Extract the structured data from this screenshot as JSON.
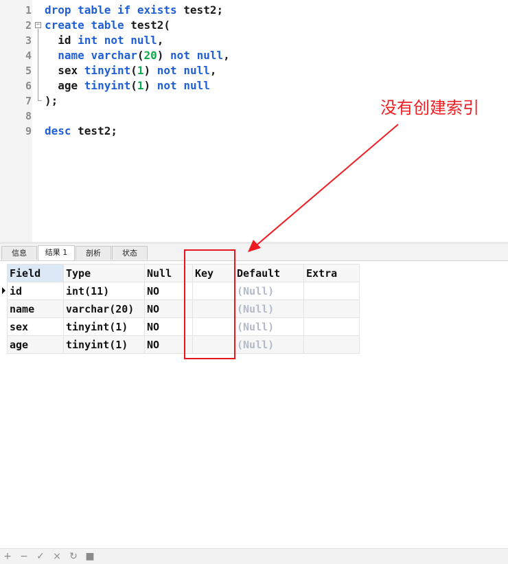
{
  "editor": {
    "line_numbers": [
      "1",
      "2",
      "3",
      "4",
      "5",
      "6",
      "7",
      "8",
      "9"
    ],
    "lines": [
      [
        {
          "t": "drop table if exists",
          "c": "kw"
        },
        {
          "t": " test2;",
          "c": ""
        }
      ],
      [
        {
          "t": "create table",
          "c": "kw"
        },
        {
          "t": " test2(",
          "c": ""
        }
      ],
      [
        {
          "t": "  id ",
          "c": ""
        },
        {
          "t": "int not null",
          "c": "kw"
        },
        {
          "t": ",",
          "c": ""
        }
      ],
      [
        {
          "t": "  name ",
          "c": "kw"
        },
        {
          "t": "varchar",
          "c": "kw"
        },
        {
          "t": "(",
          "c": ""
        },
        {
          "t": "20",
          "c": "num"
        },
        {
          "t": ") ",
          "c": ""
        },
        {
          "t": "not null",
          "c": "kw"
        },
        {
          "t": ",",
          "c": ""
        }
      ],
      [
        {
          "t": "  sex ",
          "c": ""
        },
        {
          "t": "tinyint",
          "c": "kw"
        },
        {
          "t": "(",
          "c": ""
        },
        {
          "t": "1",
          "c": "num"
        },
        {
          "t": ") ",
          "c": ""
        },
        {
          "t": "not null",
          "c": "kw"
        },
        {
          "t": ",",
          "c": ""
        }
      ],
      [
        {
          "t": "  age ",
          "c": ""
        },
        {
          "t": "tinyint",
          "c": "kw"
        },
        {
          "t": "(",
          "c": ""
        },
        {
          "t": "1",
          "c": "num"
        },
        {
          "t": ") ",
          "c": ""
        },
        {
          "t": "not null",
          "c": "kw"
        }
      ],
      [
        {
          "t": ");",
          "c": ""
        }
      ],
      [],
      [
        {
          "t": "desc",
          "c": "kw"
        },
        {
          "t": " test2;",
          "c": ""
        }
      ]
    ]
  },
  "tabs": {
    "info": "信息",
    "result1": "结果 1",
    "profile": "剖析",
    "status": "状态"
  },
  "result": {
    "columns": [
      "Field",
      "Type",
      "Null",
      "Key",
      "Default",
      "Extra"
    ],
    "rows": [
      [
        "id",
        "int(11)",
        "NO",
        "",
        "(Null)",
        ""
      ],
      [
        "name",
        "varchar(20)",
        "NO",
        "",
        "(Null)",
        ""
      ],
      [
        "sex",
        "tinyint(1)",
        "NO",
        "",
        "(Null)",
        ""
      ],
      [
        "age",
        "tinyint(1)",
        "NO",
        "",
        "(Null)",
        ""
      ]
    ]
  },
  "annotation": {
    "text": "没有创建索引",
    "color": "#ef1c22"
  },
  "toolbar": {
    "icons": [
      "plus-icon",
      "minus-icon",
      "check-icon",
      "cross-icon",
      "refresh-icon",
      "stop-icon"
    ],
    "glyphs": [
      "+",
      "−",
      "✓",
      "×",
      "↻",
      "■"
    ]
  },
  "colors": {
    "keyword": "#1f5fd6",
    "number": "#0aa84a",
    "null_text": "#b3bac8",
    "highlight_box": "#e8141c"
  }
}
